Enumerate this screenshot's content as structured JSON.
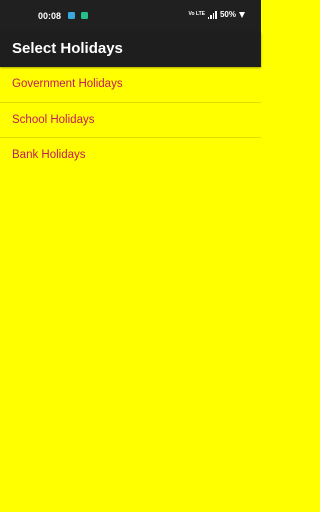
{
  "status_bar": {
    "time": "00:08",
    "network_label": "Vo LTE",
    "battery": "50%"
  },
  "app_bar": {
    "title": "Select Holidays"
  },
  "holidays": [
    {
      "label": "Government Holidays"
    },
    {
      "label": "School Holidays"
    },
    {
      "label": "Bank Holidays"
    }
  ],
  "colors": {
    "background": "#ffff00",
    "app_bar": "#1e1e1e",
    "item_text": "#c41a5a"
  }
}
